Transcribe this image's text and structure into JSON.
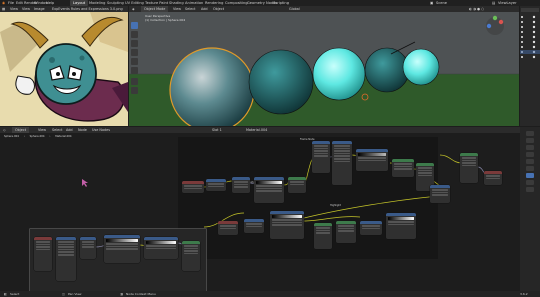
{
  "menubar": {
    "menus": [
      "File",
      "Edit",
      "Render",
      "Window",
      "Help"
    ],
    "tabs": [
      "Layout",
      "Modeling",
      "Sculpting",
      "UV Editing",
      "Texture Paint",
      "Shading",
      "Animation",
      "Rendering",
      "Compositing",
      "Geometry Nodes",
      "Scripting"
    ],
    "active_tab": "Layout",
    "scene_label": "Scene",
    "view_layer_label": "ViewLayer"
  },
  "image_editor": {
    "menus": [
      "View",
      "View",
      "Image"
    ],
    "filename": "ExpEvents Rules and Expressions 3.0.png"
  },
  "viewport": {
    "mode": "Object Mode",
    "menus": [
      "View",
      "Select",
      "Add",
      "Object"
    ],
    "orientation": "Global",
    "overlay_line1": "User Perspective",
    "overlay_line2": "(1) Collection | Sphere.004"
  },
  "node_editor": {
    "header_items": [
      "Object",
      "View",
      "Select",
      "Add",
      "Node",
      "Use Nodes"
    ],
    "breadcrumb": [
      "Sphere.004",
      "Sphere.004",
      "Material.004"
    ],
    "slot": "Slot 1",
    "material": "Material.004",
    "frame_labels": [
      "Frame Node",
      "Highlight Node",
      "Highlight"
    ]
  },
  "status_bar": {
    "select": "Select",
    "pan_view": "Pan View",
    "context_menu": "Node Context Menu",
    "version": "3.6.2"
  },
  "colors": {
    "accent": "#4772b3",
    "active_outline": "#e09a2a",
    "sphere_teal": "#1f6d72",
    "sphere_cyan": "#5ee8e2",
    "node_blue": "#3a5a88",
    "node_green": "#3d7a4b",
    "node_dark": "#2a2a2a"
  },
  "icons": [
    "select-icon",
    "cursor-icon",
    "move-icon",
    "rotate-icon",
    "scale-icon",
    "transform-icon",
    "annotate-icon",
    "measure-icon",
    "camera-icon",
    "eye-icon",
    "filter-icon"
  ]
}
